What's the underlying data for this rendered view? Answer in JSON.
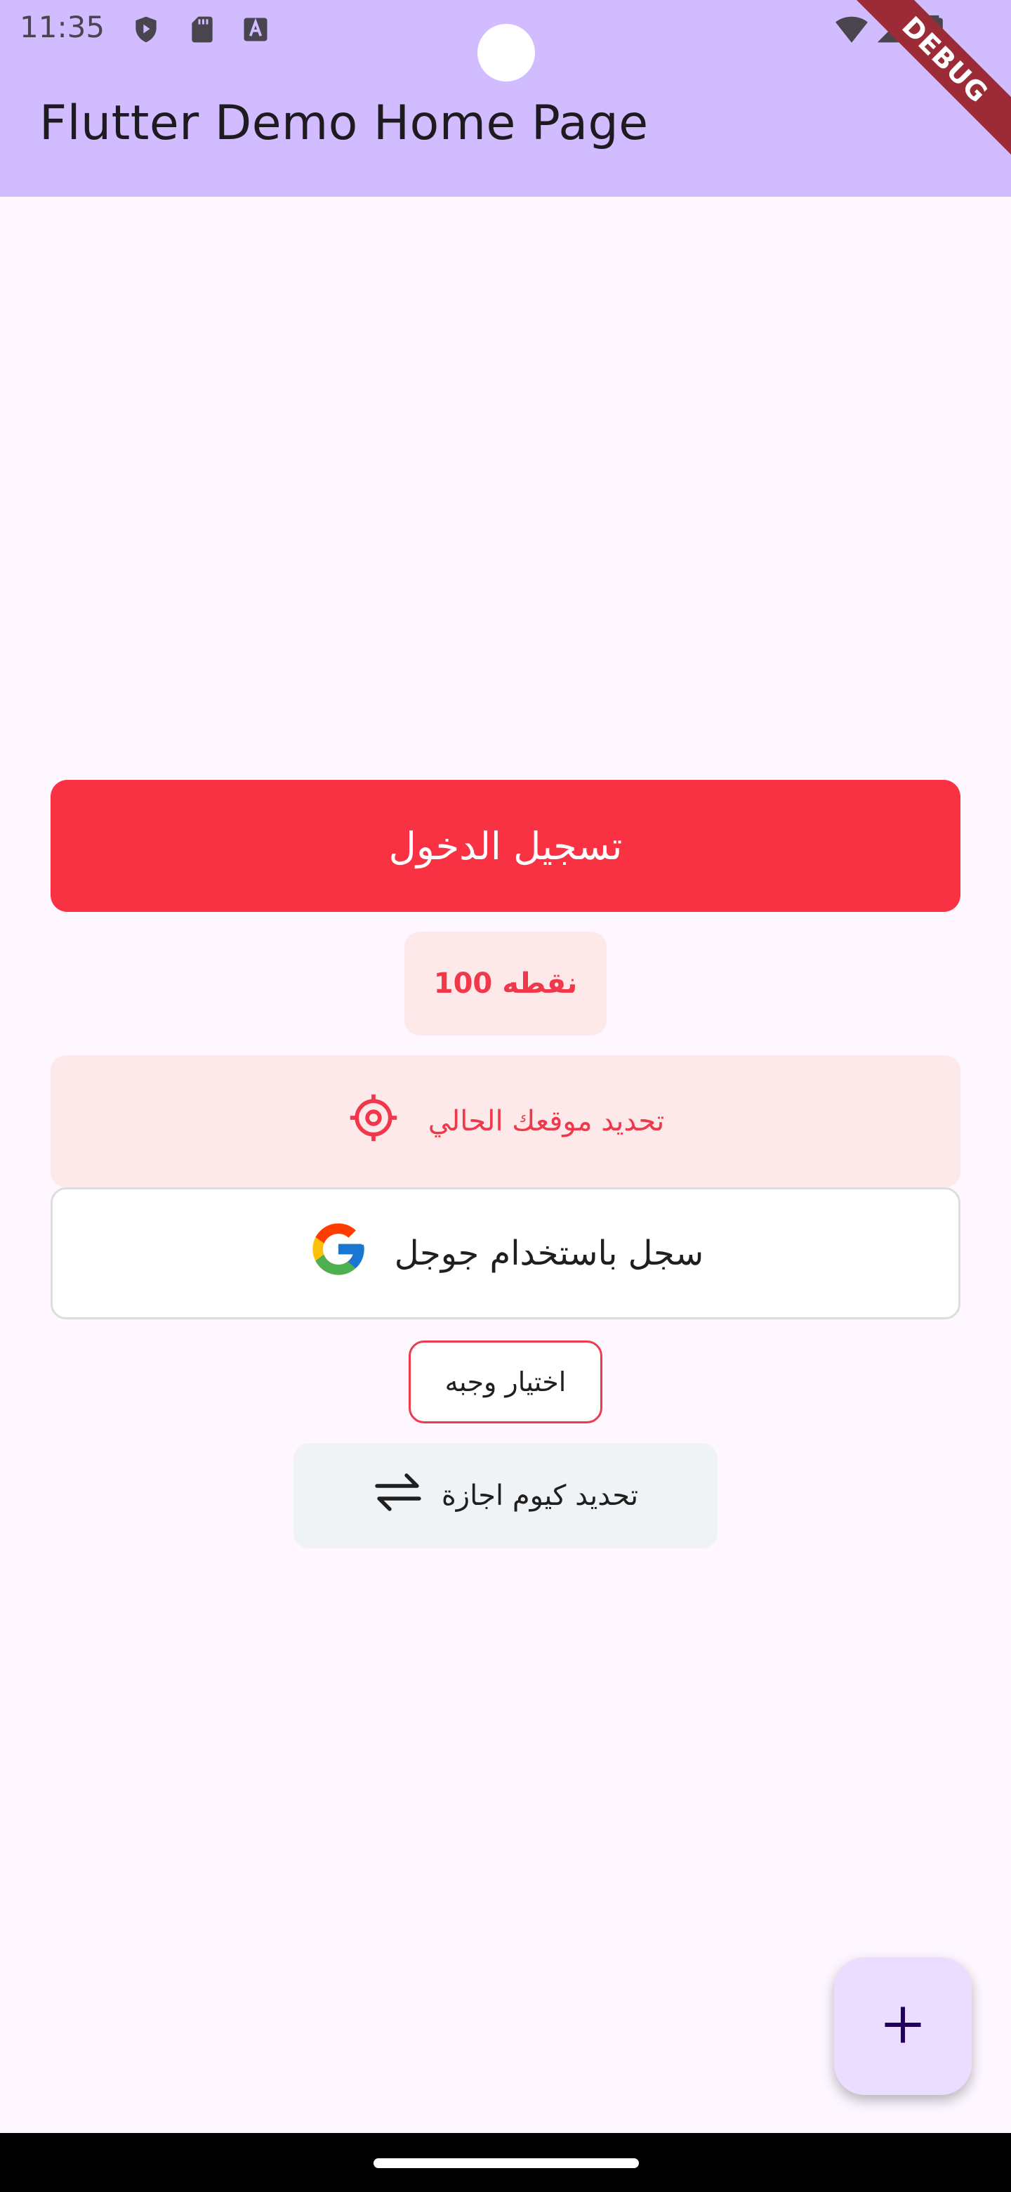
{
  "status_bar": {
    "time": "11:35",
    "left_icons": [
      "shield-play-icon",
      "sd-card-icon",
      "font-a-icon"
    ],
    "right_icons": [
      "wifi-icon",
      "signal-icon",
      "battery-icon"
    ]
  },
  "app_bar": {
    "title": "Flutter Demo Home Page",
    "background": "#d1bcff"
  },
  "debug_banner": "DEBUG",
  "buttons": {
    "login": {
      "label": "تسجيل الدخول",
      "background": "#f83243"
    },
    "points": {
      "label": "نقطه 100"
    },
    "location": {
      "label": "تحديد موقعك الحالي",
      "icon": "gps-target-icon"
    },
    "google": {
      "label": "سجل باستخدام جوجل",
      "icon": "google-logo-icon"
    },
    "meal": {
      "label": "اختيار وجبه"
    },
    "holiday": {
      "label": "تحديد كيوم اجازة",
      "icon": "swap-arrows-icon"
    }
  },
  "fab": {
    "icon": "plus-icon",
    "background": "#eaddff"
  },
  "colors": {
    "accent_red": "#f83243",
    "page_background": "#fef7ff"
  }
}
